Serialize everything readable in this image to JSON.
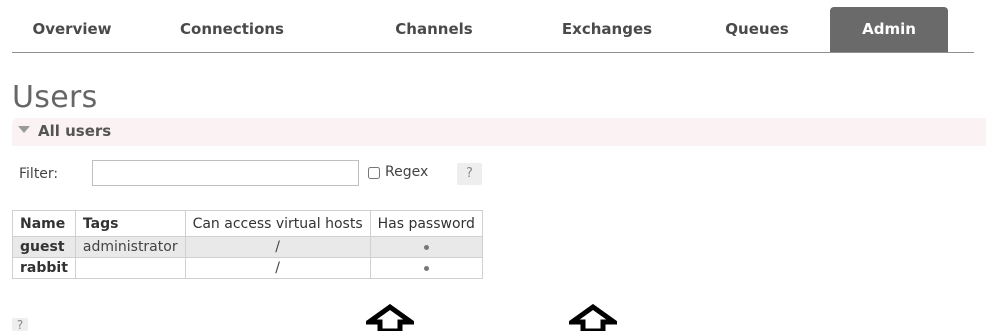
{
  "tabs": [
    {
      "label": "Overview"
    },
    {
      "label": "Connections"
    },
    {
      "label": "Channels"
    },
    {
      "label": "Exchanges"
    },
    {
      "label": "Queues"
    },
    {
      "label": "Admin",
      "active": true
    }
  ],
  "page_title": "Users",
  "section": {
    "label": "All users"
  },
  "filter": {
    "label": "Filter:",
    "value": "",
    "regex_label": "Regex",
    "help": "?"
  },
  "table": {
    "headers": [
      "Name",
      "Tags",
      "Can access virtual hosts",
      "Has password"
    ],
    "rows": [
      {
        "name": "guest",
        "tags": "administrator",
        "vhosts": "/",
        "has_password": "•"
      },
      {
        "name": "rabbit",
        "tags": "",
        "vhosts": "/",
        "has_password": "•"
      }
    ]
  },
  "footer_help": "?",
  "colors": {
    "active_tab": "#6a6a6a",
    "section_bg": "#fbf3f3",
    "row_alt": "#e9e9e9"
  }
}
